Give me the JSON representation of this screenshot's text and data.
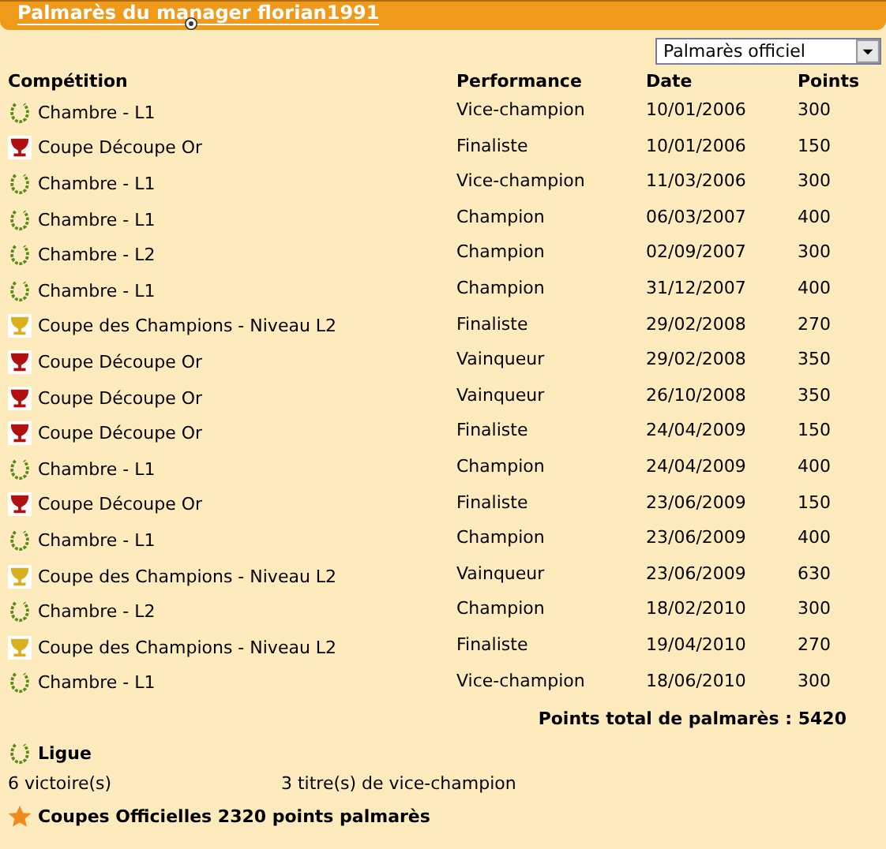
{
  "header": {
    "title": "Palmarès du manager florian1991"
  },
  "filter": {
    "value": "Palmarès officiel"
  },
  "table": {
    "columns": [
      "Compétition",
      "Performance",
      "Date",
      "Points"
    ],
    "rows": [
      {
        "kind": "laurel",
        "competition": "Chambre - L1",
        "performance": "Vice-champion",
        "date": "10/01/2006",
        "points": "300"
      },
      {
        "kind": "red-cup",
        "competition": "Coupe Découpe Or",
        "performance": "Finaliste",
        "date": "10/01/2006",
        "points": "150"
      },
      {
        "kind": "laurel",
        "competition": "Chambre - L1",
        "performance": "Vice-champion",
        "date": "11/03/2006",
        "points": "300"
      },
      {
        "kind": "laurel",
        "competition": "Chambre - L1",
        "performance": "Champion",
        "date": "06/03/2007",
        "points": "400"
      },
      {
        "kind": "laurel",
        "competition": "Chambre - L2",
        "performance": "Champion",
        "date": "02/09/2007",
        "points": "300"
      },
      {
        "kind": "laurel",
        "competition": "Chambre - L1",
        "performance": "Champion",
        "date": "31/12/2007",
        "points": "400"
      },
      {
        "kind": "gold-cup",
        "competition": "Coupe des Champions - Niveau L2",
        "performance": "Finaliste",
        "date": "29/02/2008",
        "points": "270"
      },
      {
        "kind": "red-cup",
        "competition": "Coupe Découpe Or",
        "performance": "Vainqueur",
        "date": "29/02/2008",
        "points": "350"
      },
      {
        "kind": "red-cup",
        "competition": "Coupe Découpe Or",
        "performance": "Vainqueur",
        "date": "26/10/2008",
        "points": "350"
      },
      {
        "kind": "red-cup",
        "competition": "Coupe Découpe Or",
        "performance": "Finaliste",
        "date": "24/04/2009",
        "points": "150"
      },
      {
        "kind": "laurel",
        "competition": "Chambre - L1",
        "performance": "Champion",
        "date": "24/04/2009",
        "points": "400"
      },
      {
        "kind": "red-cup",
        "competition": "Coupe Découpe Or",
        "performance": "Finaliste",
        "date": "23/06/2009",
        "points": "150"
      },
      {
        "kind": "laurel",
        "competition": "Chambre - L1",
        "performance": "Champion",
        "date": "23/06/2009",
        "points": "400"
      },
      {
        "kind": "gold-cup",
        "competition": "Coupe des Champions - Niveau L2",
        "performance": "Vainqueur",
        "date": "23/06/2009",
        "points": "630"
      },
      {
        "kind": "laurel",
        "competition": "Chambre - L2",
        "performance": "Champion",
        "date": "18/02/2010",
        "points": "300"
      },
      {
        "kind": "gold-cup",
        "competition": "Coupe des Champions - Niveau L2",
        "performance": "Finaliste",
        "date": "19/04/2010",
        "points": "270"
      },
      {
        "kind": "laurel",
        "competition": "Chambre - L1",
        "performance": "Vice-champion",
        "date": "18/06/2010",
        "points": "300"
      }
    ],
    "total": "Points total de palmarès : 5420"
  },
  "sections": [
    {
      "kind": "laurel",
      "title": "Ligue",
      "stats": [
        "6 victoire(s)",
        "3 titre(s) de vice-champion"
      ]
    },
    {
      "kind": "star",
      "title": "Coupes Officielles 2320 points palmarès"
    }
  ]
}
